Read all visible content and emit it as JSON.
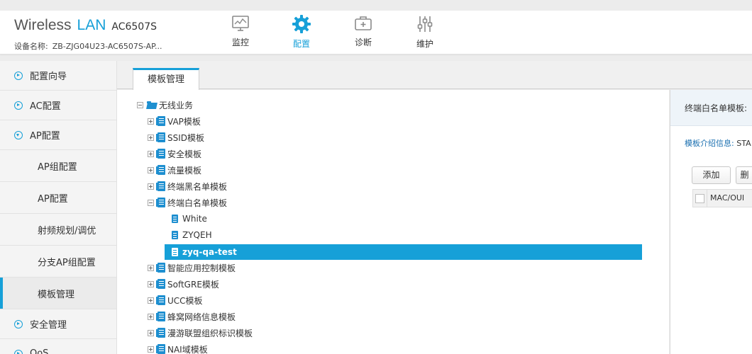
{
  "header": {
    "brand_word": "Wireless",
    "brand_lan": "LAN",
    "model": "AC6507S",
    "device_label": "设备名称:",
    "device_name": "ZB-ZJG04U23-AC6507S-AP...",
    "nav": [
      {
        "label": "监控",
        "icon": "monitor-icon",
        "active": false
      },
      {
        "label": "配置",
        "icon": "gear-icon",
        "active": true
      },
      {
        "label": "诊断",
        "icon": "toolbox-icon",
        "active": false
      },
      {
        "label": "维护",
        "icon": "sliders-icon",
        "active": false
      }
    ]
  },
  "sidebar": {
    "items": [
      {
        "label": "配置向导",
        "expanded": false
      },
      {
        "label": "AC配置",
        "expanded": false
      },
      {
        "label": "AP配置",
        "expanded": true
      },
      {
        "label": "AP组配置"
      },
      {
        "label": "AP配置"
      },
      {
        "label": "射频规划/调优"
      },
      {
        "label": "分支AP组配置"
      },
      {
        "label": "模板管理",
        "active": true
      },
      {
        "label": "安全管理",
        "expanded": false
      },
      {
        "label": "QoS",
        "expanded": false
      }
    ]
  },
  "tab": {
    "label": "模板管理"
  },
  "tree": {
    "root": "无线业务",
    "nodes": [
      {
        "label": "VAP模板",
        "state": "collapsed"
      },
      {
        "label": "SSID模板",
        "state": "collapsed"
      },
      {
        "label": "安全模板",
        "state": "collapsed"
      },
      {
        "label": "流量模板",
        "state": "collapsed"
      },
      {
        "label": "终端黑名单模板",
        "state": "collapsed"
      },
      {
        "label": "终端白名单模板",
        "state": "expanded"
      },
      {
        "label": "智能应用控制模板",
        "state": "collapsed"
      },
      {
        "label": "SoftGRE模板",
        "state": "collapsed"
      },
      {
        "label": "UCC模板",
        "state": "collapsed"
      },
      {
        "label": "蜂窝网络信息模板",
        "state": "collapsed"
      },
      {
        "label": "漫游联盟组织标识模板",
        "state": "collapsed"
      },
      {
        "label": "NAI域模板",
        "state": "collapsed"
      }
    ],
    "children": [
      {
        "label": "White"
      },
      {
        "label": "ZYQEH"
      },
      {
        "label": "zyq-qa-test",
        "selected": true
      }
    ]
  },
  "right_panel": {
    "title": "终端白名单模板:",
    "intro_label": "模板介绍信息:",
    "intro_value": "STA",
    "add_button": "添加",
    "delete_button": "删",
    "column_header": "MAC/OUI"
  },
  "colors": {
    "accent": "#16a0d8",
    "selection": "#16a0d8",
    "icon_blue": "#1e8fd0"
  }
}
